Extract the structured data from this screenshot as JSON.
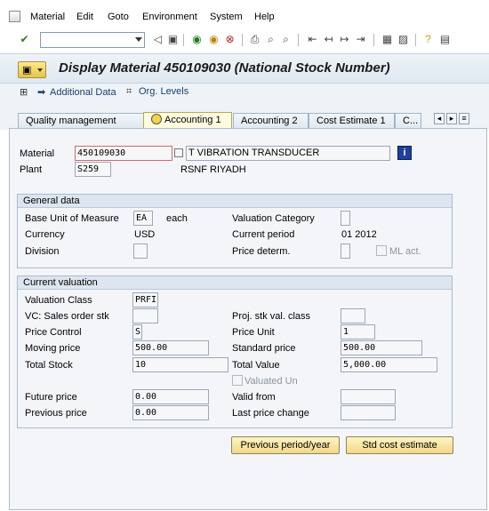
{
  "menu": {
    "items": [
      "Material",
      "Edit",
      "Goto",
      "Environment",
      "System",
      "Help"
    ]
  },
  "toolbar": {
    "command_field_value": ""
  },
  "title": "Display Material 450109030 (National Stock Number)",
  "app_toolbar": {
    "additional_data": "Additional Data",
    "org_levels": "Org. Levels"
  },
  "tabs": [
    {
      "label": "Quality management",
      "active": false
    },
    {
      "label": "Accounting 1",
      "active": true
    },
    {
      "label": "Accounting 2",
      "active": false
    },
    {
      "label": "Cost Estimate 1",
      "active": false
    },
    {
      "label": "C...",
      "active": false
    }
  ],
  "header": {
    "material_label": "Material",
    "material_value": "450109030",
    "material_desc": "T VIBRATION TRANSDUCER",
    "plant_label": "Plant",
    "plant_value": "S259",
    "plant_desc": "RSNF RIYADH"
  },
  "general_data": {
    "title": "General data",
    "base_uom_label": "Base Unit of Measure",
    "base_uom_value": "EA",
    "base_uom_text": "each",
    "valuation_category_label": "Valuation Category",
    "valuation_category_value": "",
    "currency_label": "Currency",
    "currency_value": "USD",
    "current_period_label": "Current period",
    "current_period_value": "01 2012",
    "division_label": "Division",
    "division_value": "",
    "price_determ_label": "Price determ.",
    "price_determ_value": "",
    "ml_act_label": "ML act."
  },
  "current_valuation": {
    "title": "Current valuation",
    "valuation_class_label": "Valuation Class",
    "valuation_class_value": "PRFI",
    "vc_sales_order_label": "VC: Sales order stk",
    "vc_sales_order_value": "",
    "proj_stk_label": "Proj. stk val. class",
    "proj_stk_value": "",
    "price_control_label": "Price Control",
    "price_control_value": "S",
    "price_unit_label": "Price Unit",
    "price_unit_value": "1",
    "moving_price_label": "Moving price",
    "moving_price_value": "500.00",
    "standard_price_label": "Standard price",
    "standard_price_value": "500.00",
    "total_stock_label": "Total Stock",
    "total_stock_value": "10",
    "total_value_label": "Total Value",
    "total_value_value": "5,000.00",
    "valuated_un_label": "Valuated Un",
    "future_price_label": "Future price",
    "future_price_value": "0.00",
    "valid_from_label": "Valid from",
    "valid_from_value": "",
    "previous_price_label": "Previous price",
    "previous_price_value": "0.00",
    "last_price_change_label": "Last price change",
    "last_price_change_value": ""
  },
  "buttons": {
    "previous_period": "Previous period/year",
    "std_cost_estimate": "Std cost estimate"
  }
}
